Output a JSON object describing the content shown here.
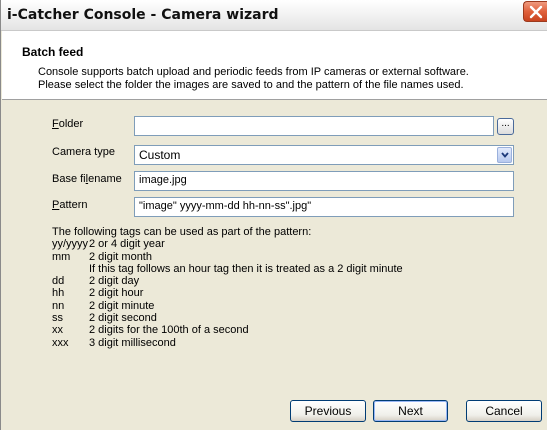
{
  "window": {
    "title": "i-Catcher Console - Camera wizard"
  },
  "header": {
    "title": "Batch feed",
    "description_line1": "Console supports batch upload and periodic feeds from IP cameras or external software.",
    "description_line2": "Please select the folder the images are saved to and the pattern of the file names used."
  },
  "form": {
    "folder": {
      "label_u": "F",
      "label_rest": "older",
      "value": "",
      "browse_label": "..."
    },
    "camera_type": {
      "label": "Camera type",
      "value": "Custom"
    },
    "base_filename": {
      "label_a": "Base fi",
      "label_u": "l",
      "label_b": "ename",
      "value": "image.jpg"
    },
    "pattern": {
      "label_u": "P",
      "label_rest": "attern",
      "value": "\"image\" yyyy-mm-dd hh-nn-ss\".jpg\""
    }
  },
  "tags": {
    "intro": "The following tags can be used as part of the pattern:",
    "rows": [
      {
        "key": "yy/yyyy",
        "desc": "2 or 4 digit year"
      },
      {
        "key": "mm",
        "desc": "2 digit month"
      },
      {
        "key": "",
        "desc": "If this tag follows an hour tag then it is treated as a 2 digit minute"
      },
      {
        "key": "dd",
        "desc": "2 digit day"
      },
      {
        "key": "hh",
        "desc": "2 digit hour"
      },
      {
        "key": "nn",
        "desc": "2 digit minute"
      },
      {
        "key": "ss",
        "desc": "2 digit second"
      },
      {
        "key": "xx",
        "desc": "2 digits for the 100th of a second"
      },
      {
        "key": "xxx",
        "desc": "3 digit millisecond"
      }
    ]
  },
  "buttons": {
    "previous": "Previous",
    "next": "Next",
    "cancel": "Cancel"
  },
  "icons": {
    "close": "close-icon",
    "dropdown": "chevron-down-icon"
  },
  "colors": {
    "dialog_bg": "#ece9d8",
    "close_button": "#e0613c",
    "input_border": "#7f9db9",
    "button_border": "#003c74"
  }
}
